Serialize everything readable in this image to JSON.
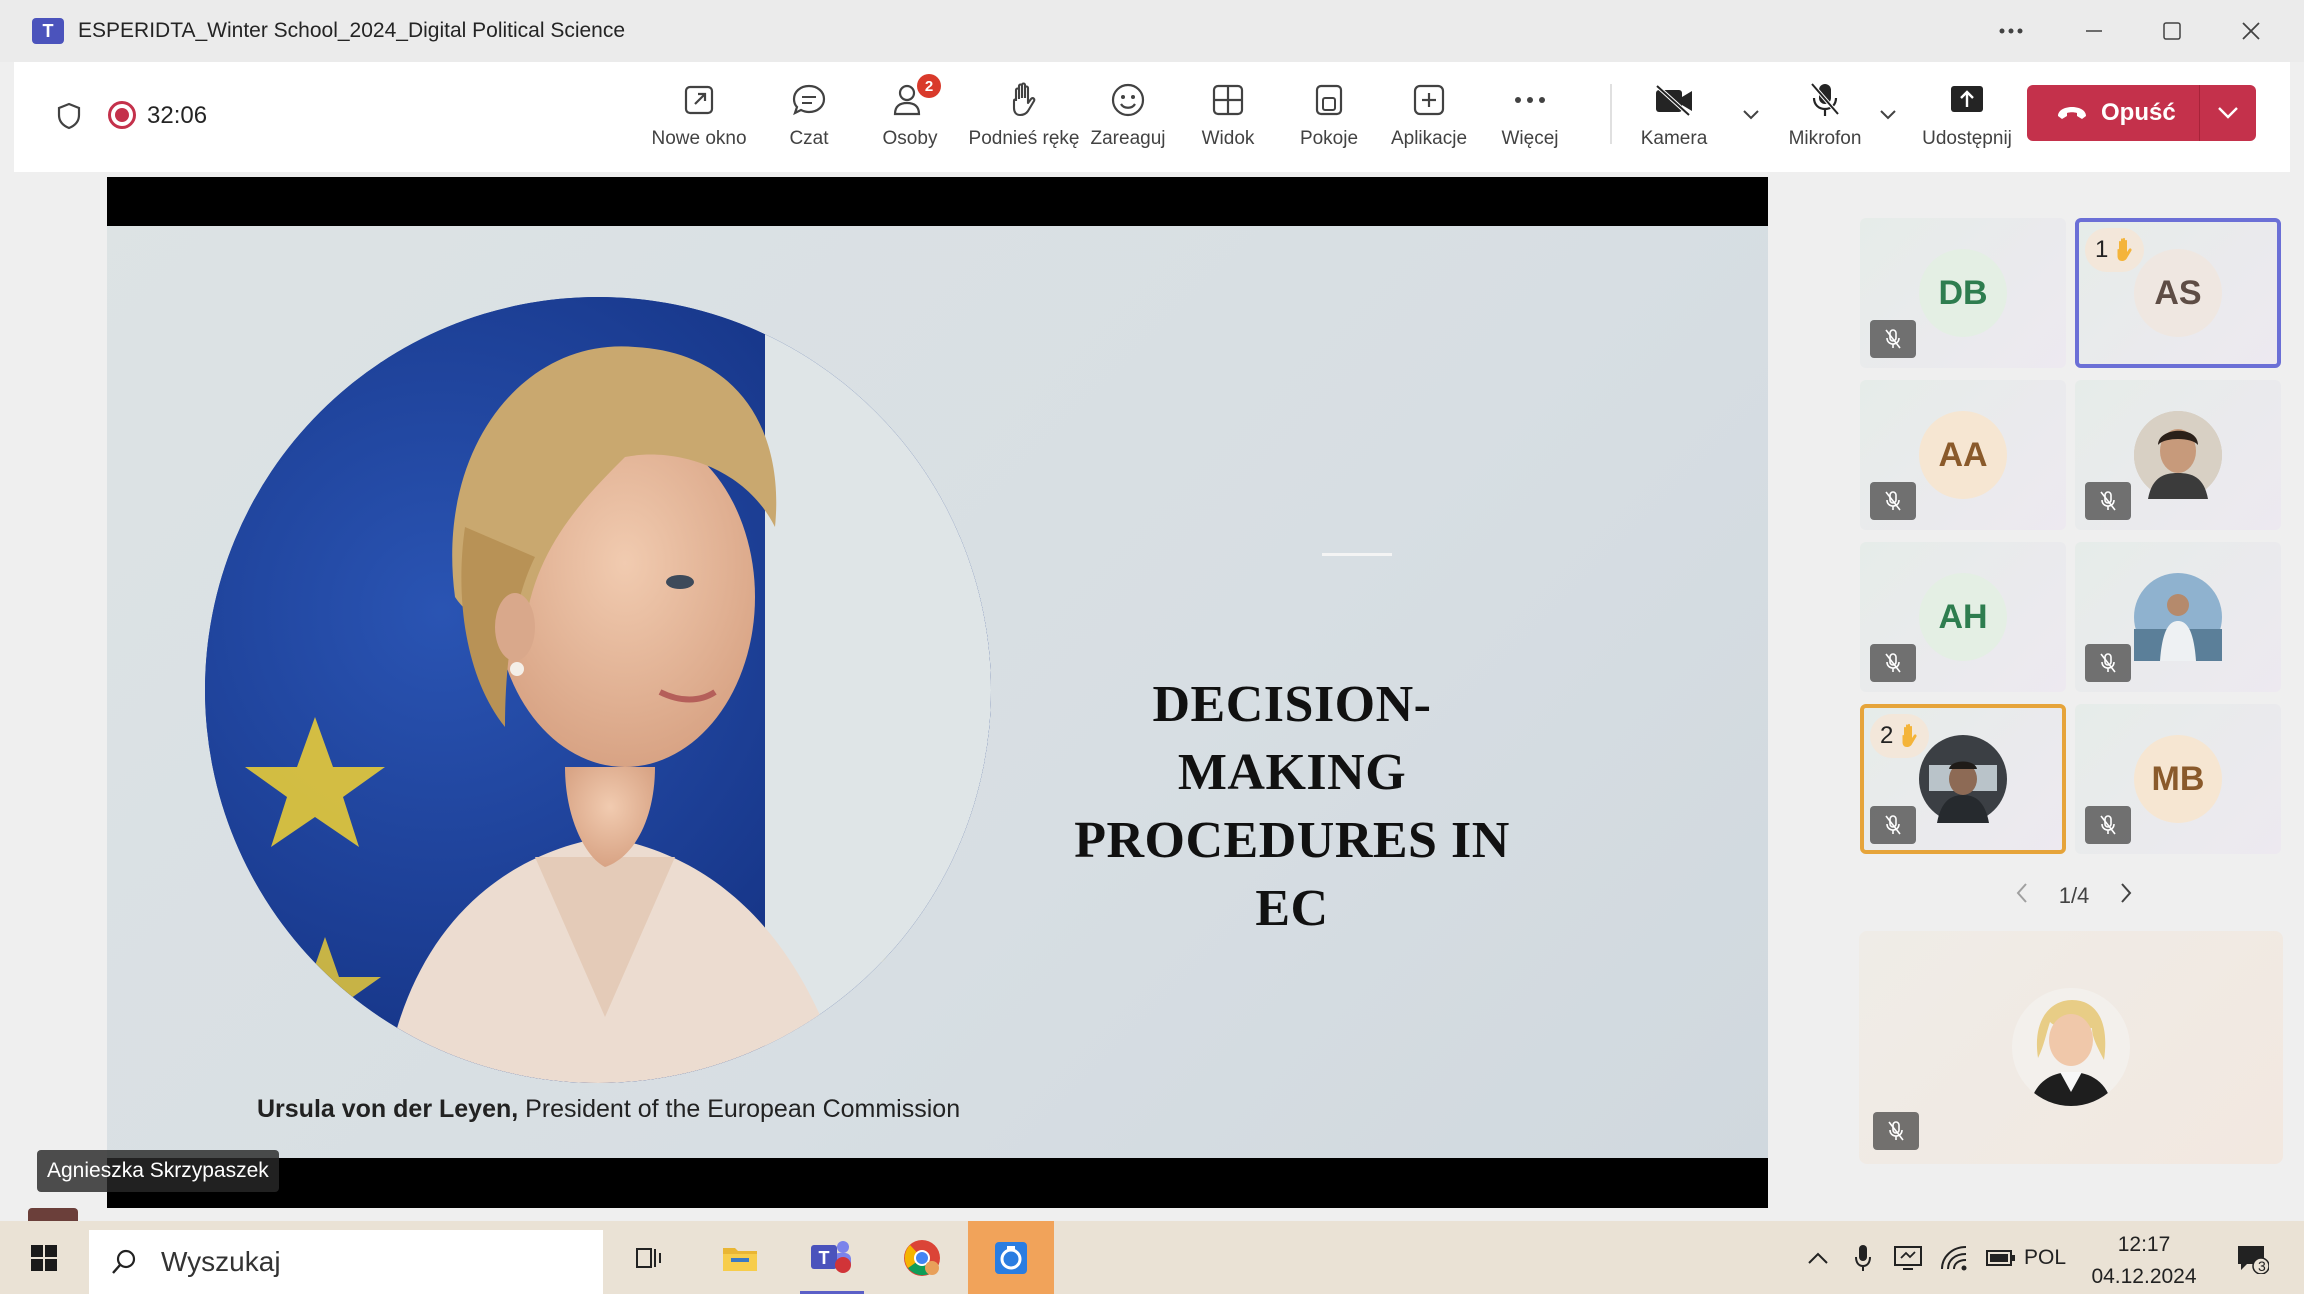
{
  "window": {
    "app_icon": "teams-icon",
    "title": "ESPERIDTA_Winter School_2024_Digital Political Science",
    "controls": [
      "more-icon",
      "minimize-icon",
      "maximize-icon",
      "close-icon"
    ]
  },
  "toolbar": {
    "timer": "32:06",
    "buttons": [
      {
        "label": "Nowe okno",
        "icon": "pop-out-icon"
      },
      {
        "label": "Czat",
        "icon": "chat-icon"
      },
      {
        "label": "Osoby",
        "icon": "people-icon",
        "badge": "2"
      },
      {
        "label": "Podnieś rękę",
        "icon": "raise-hand-icon"
      },
      {
        "label": "Zareaguj",
        "icon": "emoji-icon"
      },
      {
        "label": "Widok",
        "icon": "grid-view-icon"
      },
      {
        "label": "Pokoje",
        "icon": "rooms-icon"
      },
      {
        "label": "Aplikacje",
        "icon": "add-apps-icon"
      },
      {
        "label": "Więcej",
        "icon": "more-icon"
      },
      {
        "label": "Kamera",
        "icon": "camera-off-icon"
      },
      {
        "label": "Mikrofon",
        "icon": "mic-off-icon"
      },
      {
        "label": "Udostępnij",
        "icon": "share-icon"
      }
    ],
    "leave_label": "Opuść",
    "leave_color": "#c4314b"
  },
  "slide": {
    "title_line1": "DECISION-MAKING",
    "title_line2": "PROCEDURES IN EC",
    "caption_bold": "Ursula von der Leyen,",
    "caption_rest": " President of the European Commission"
  },
  "speaker_name": "Agnieszka Skrzypaszek",
  "participants": [
    {
      "initials": "DB",
      "muted": true
    },
    {
      "initials": "AS",
      "hand_order": "1",
      "highlight": "#6b6fd6"
    },
    {
      "initials": "AA",
      "muted": true
    },
    {
      "photo": true,
      "muted": true
    },
    {
      "initials": "AH",
      "muted": true
    },
    {
      "photo": true,
      "muted": true
    },
    {
      "photo": true,
      "hand_order": "2",
      "muted": true,
      "highlight": "#e6a43a"
    },
    {
      "initials": "MB",
      "muted": true
    }
  ],
  "pager": {
    "text": "1/4"
  },
  "taskbar": {
    "search_placeholder": "Wyszukaj",
    "language": "POL",
    "time": "12:17",
    "date": "04.12.2024",
    "notifications": "3"
  }
}
